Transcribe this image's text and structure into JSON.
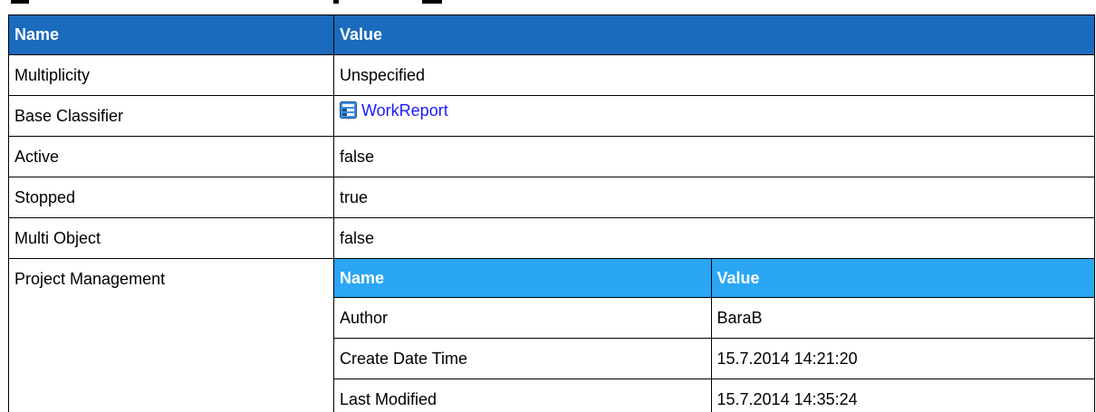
{
  "header": {
    "name": "Name",
    "value": "Value"
  },
  "rows": [
    {
      "name": "Multiplicity",
      "value": "Unspecified"
    },
    {
      "name": "Base Classifier",
      "value": "WorkReport",
      "icon": "class-icon"
    },
    {
      "name": "Active",
      "value": "false"
    },
    {
      "name": "Stopped",
      "value": "true"
    },
    {
      "name": "Multi Object",
      "value": "false"
    }
  ],
  "project": {
    "name": "Project Management",
    "header": {
      "name": "Name",
      "value": "Value"
    },
    "rows": [
      {
        "name": "Author",
        "value": "BaraB"
      },
      {
        "name": "Create Date Time",
        "value": "15.7.2014 14:21:20"
      },
      {
        "name": "Last Modified",
        "value": "15.7.2014 14:35:24"
      }
    ]
  },
  "colors": {
    "header_bg": "#1a6bbd",
    "nested_header_bg": "#2aa6f5",
    "link": "#1a1aff"
  }
}
